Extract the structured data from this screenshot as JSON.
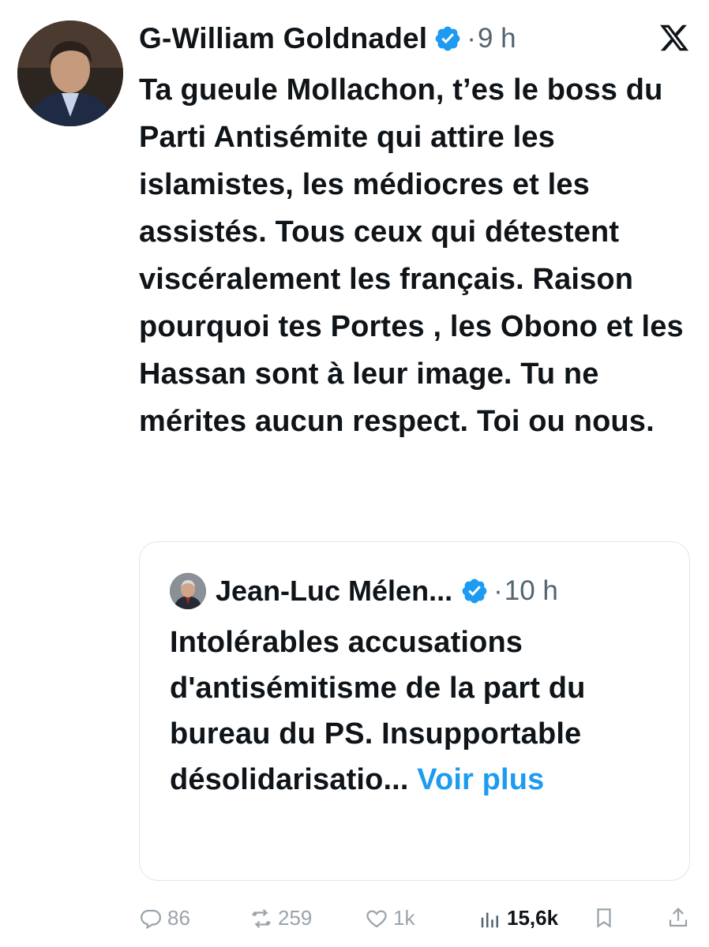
{
  "post": {
    "author": "G-William Goldnadel",
    "separator": "·",
    "time": "9 h",
    "text": "Ta gueule Mollachon, t’es le boss du Parti Antisémite qui attire les islamistes, les médiocres et les assistés. Tous ceux qui détestent viscéralement les français. Raison pourquoi tes Portes , les Obono et les Hassan sont à leur image. Tu ne mérites aucun respect. Toi ou nous.",
    "avatar_icon": "person-avatar",
    "verified_icon": "verified-badge-icon",
    "platform_icon": "x-logo-icon"
  },
  "quoted_post": {
    "author": "Jean-Luc Mélen...",
    "separator": "·",
    "time": "10 h",
    "text": "Intolérables accusations d'antisémitisme de la part du bureau du PS. Insupportable désolidarisatio...",
    "more_label": "Voir plus"
  },
  "actions": {
    "replies": "86",
    "reposts": "259",
    "likes": "1k",
    "views": "15,6k"
  },
  "colors": {
    "accent": "#1d9bf0",
    "text": "#0f1419",
    "muted": "#536471",
    "action_icons": "#9aa4ac"
  }
}
